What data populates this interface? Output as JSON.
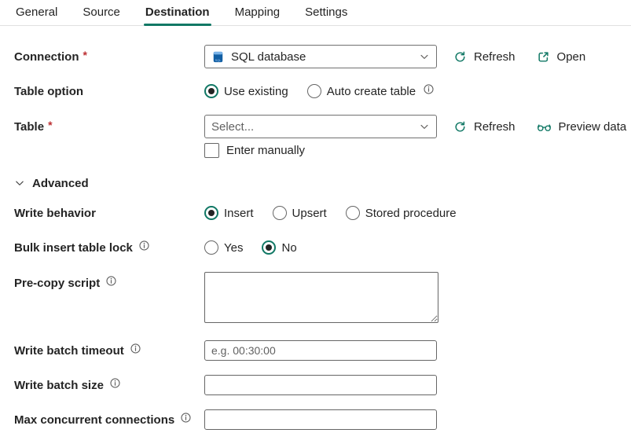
{
  "colors": {
    "accent_teal": "#117865",
    "input_border": "#666666",
    "text": "#242424",
    "placeholder_gray": "#616161",
    "required_red": "#bc2f32",
    "sql_icon_blue": "#115EA3",
    "tab_divider": "#e0e0e0"
  },
  "ui": {
    "required_mark": "*"
  },
  "tabs": {
    "items": [
      {
        "label": "General",
        "active": false
      },
      {
        "label": "Source",
        "active": false
      },
      {
        "label": "Destination",
        "active": true
      },
      {
        "label": "Mapping",
        "active": false
      },
      {
        "label": "Settings",
        "active": false
      }
    ]
  },
  "connection": {
    "label": "Connection",
    "value": "SQL database",
    "refresh_label": "Refresh",
    "open_label": "Open"
  },
  "table_option": {
    "label": "Table option",
    "options": [
      "Use existing",
      "Auto create table"
    ],
    "selected": "Use existing"
  },
  "table": {
    "label": "Table",
    "placeholder": "Select...",
    "refresh_label": "Refresh",
    "preview_label": "Preview data",
    "manual_checkbox_label": "Enter manually",
    "manual_checked": false
  },
  "advanced": {
    "label": "Advanced",
    "expanded": true
  },
  "write_behavior": {
    "label": "Write behavior",
    "options": [
      "Insert",
      "Upsert",
      "Stored procedure"
    ],
    "selected": "Insert"
  },
  "bulk_insert_table_lock": {
    "label": "Bulk insert table lock",
    "options": [
      "Yes",
      "No"
    ],
    "selected": "No"
  },
  "pre_copy_script": {
    "label": "Pre-copy script",
    "value": ""
  },
  "write_batch_timeout": {
    "label": "Write batch timeout",
    "placeholder": "e.g. 00:30:00",
    "value": ""
  },
  "write_batch_size": {
    "label": "Write batch size",
    "value": ""
  },
  "max_concurrent_connections": {
    "label": "Max concurrent connections",
    "value": ""
  }
}
